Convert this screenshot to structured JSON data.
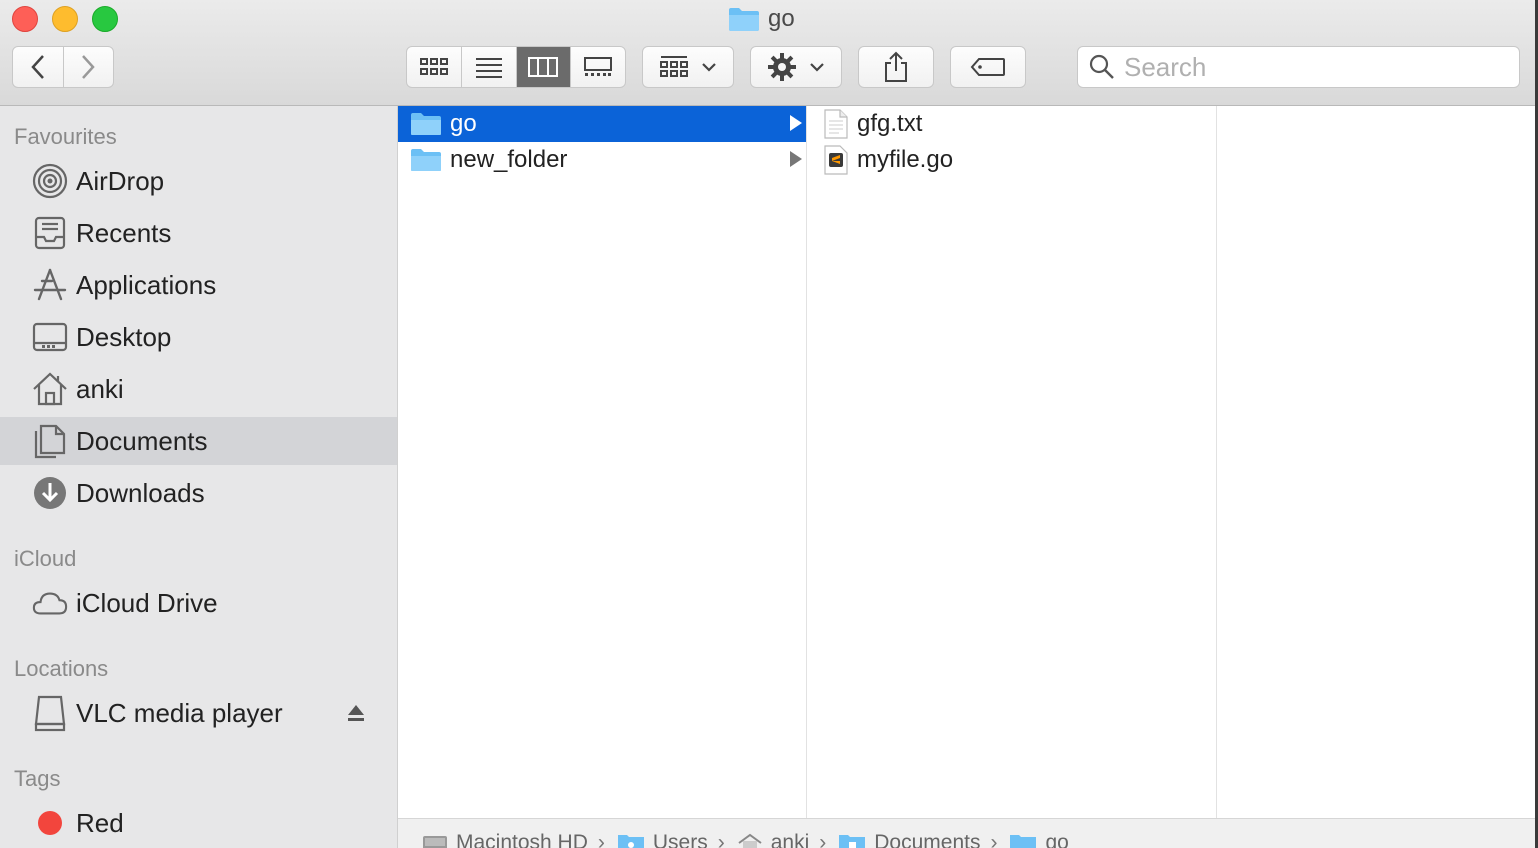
{
  "window": {
    "title": "go"
  },
  "toolbar": {
    "search_placeholder": "Search"
  },
  "sidebar": {
    "sections": [
      {
        "title": "Favourites"
      },
      {
        "title": "iCloud"
      },
      {
        "title": "Locations"
      },
      {
        "title": "Tags"
      }
    ],
    "favourites": [
      {
        "label": "AirDrop",
        "icon": "airdrop-icon"
      },
      {
        "label": "Recents",
        "icon": "recents-icon"
      },
      {
        "label": "Applications",
        "icon": "applications-icon"
      },
      {
        "label": "Desktop",
        "icon": "desktop-icon"
      },
      {
        "label": "anki",
        "icon": "home-icon"
      },
      {
        "label": "Documents",
        "icon": "documents-icon",
        "selected": true
      },
      {
        "label": "Downloads",
        "icon": "downloads-icon"
      }
    ],
    "icloud": [
      {
        "label": "iCloud Drive",
        "icon": "cloud-icon"
      }
    ],
    "locations": [
      {
        "label": "VLC media player",
        "icon": "disk-icon"
      }
    ],
    "tags": [
      {
        "label": "Red",
        "color": "#f2453d"
      }
    ]
  },
  "columns": {
    "col1": [
      {
        "name": "go",
        "selected": true
      },
      {
        "name": "new_folder"
      }
    ],
    "col2": [
      {
        "name": "gfg.txt",
        "icon": "text-file-icon"
      },
      {
        "name": "myfile.go",
        "icon": "sublime-file-icon"
      }
    ]
  },
  "pathbar": [
    {
      "label": "Macintosh HD"
    },
    {
      "label": "Users"
    },
    {
      "label": "anki"
    },
    {
      "label": "Documents"
    },
    {
      "label": "go"
    }
  ],
  "colors": {
    "selection": "#0b63d8",
    "folder": "#6cc0f5",
    "tag_red": "#f2453d"
  }
}
